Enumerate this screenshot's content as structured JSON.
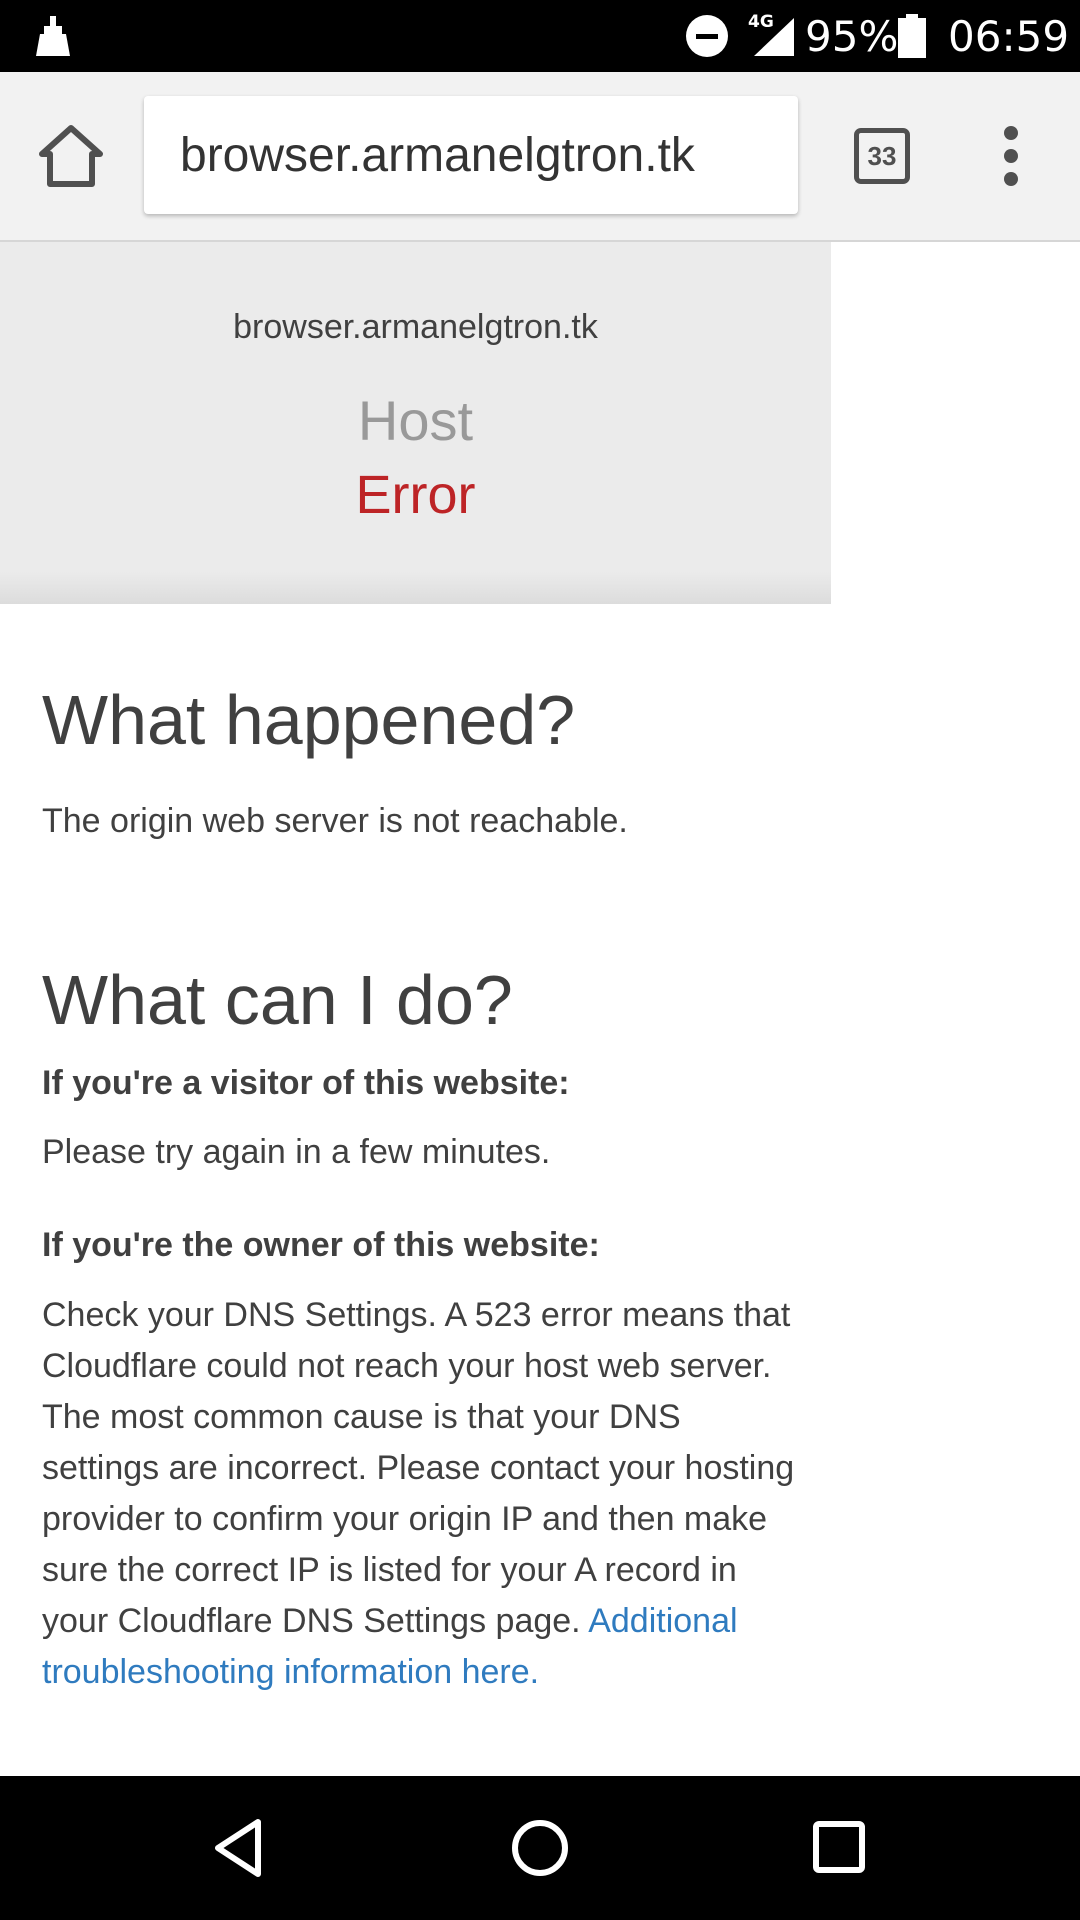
{
  "status_bar": {
    "network": "4G",
    "battery": "95%",
    "time": "06:59",
    "icons": [
      "notification-icon",
      "dnd-icon",
      "signal-icon",
      "battery-icon"
    ]
  },
  "toolbar": {
    "url": "browser.armanelgtron.tk",
    "tab_count": "33",
    "icons": [
      "home-icon",
      "tabs-icon",
      "more-icon"
    ]
  },
  "error_header": {
    "domain": "browser.armanelgtron.tk",
    "host": "Host",
    "error": "Error"
  },
  "what_happened": {
    "title": "What happened?",
    "text": "The origin web server is not reachable."
  },
  "what_can_i_do": {
    "title": "What can I do?",
    "visitor_label": "If you're a visitor of this website:",
    "visitor_text": "Please try again in a few minutes.",
    "owner_label": "If you're the owner of this website:",
    "owner_text": "Check your DNS Settings. A 523 error means that Cloudflare could not reach your host web server. The most common cause is that your DNS settings are incorrect. Please contact your hosting provider to confirm your origin IP and then make sure the correct IP is listed for your A record in your Cloudflare DNS Settings page.",
    "owner_link": "Additional troubleshooting information here."
  },
  "nav_bar": {
    "icons": [
      "back-icon",
      "home-nav-icon",
      "recents-icon"
    ]
  },
  "colors": {
    "error_red": "#bd2426",
    "link_blue": "#2f7bbf",
    "header_bg": "#ebebeb"
  }
}
